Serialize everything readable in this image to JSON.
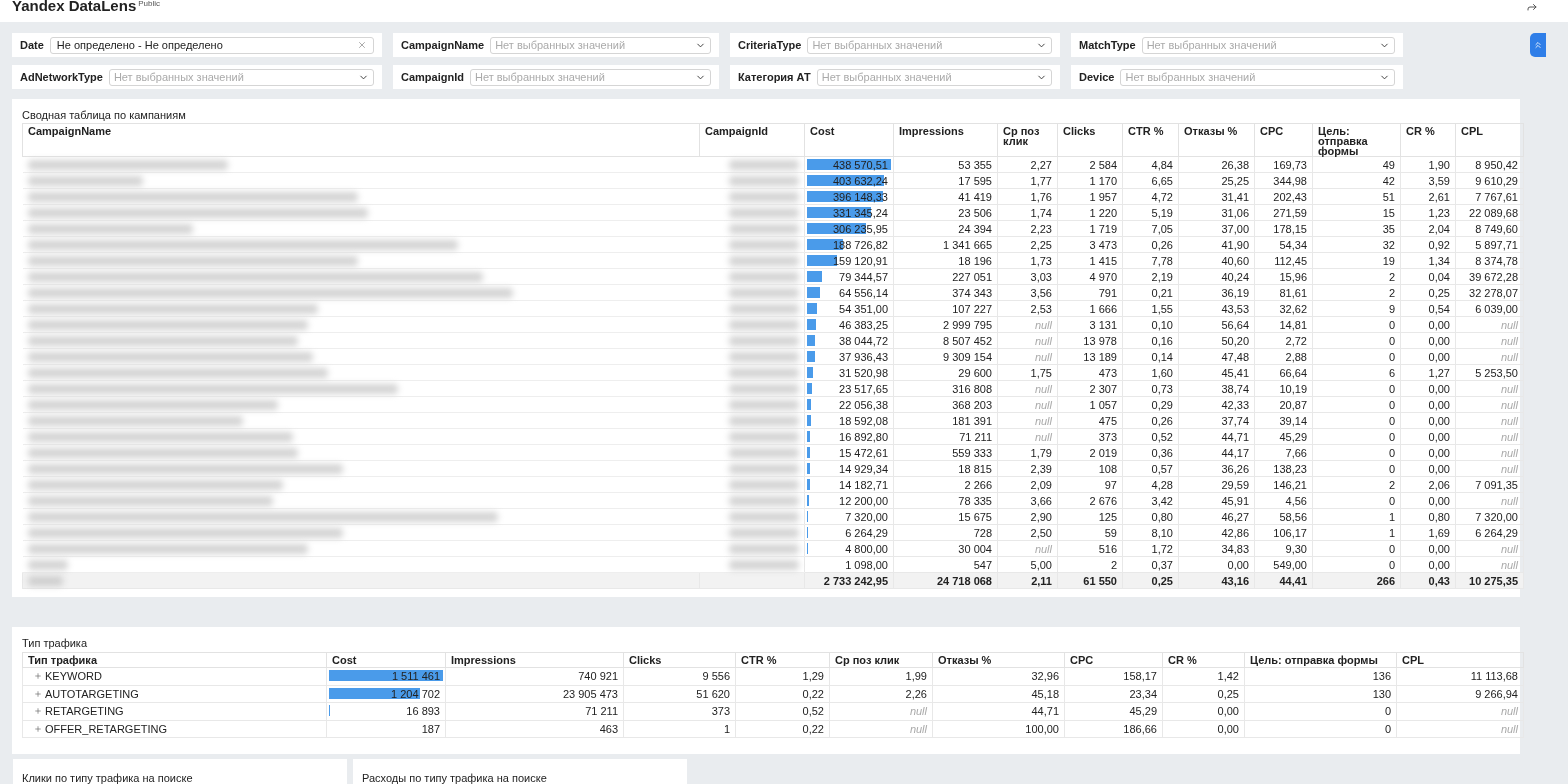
{
  "app": {
    "title": "Yandex DataLens",
    "badge": "Public"
  },
  "filters": [
    {
      "kind": "date",
      "label": "Date",
      "value": "Не определено - Не определено"
    },
    {
      "kind": "select",
      "label": "CampaignName",
      "placeholder": "Нет выбранных значений"
    },
    {
      "kind": "select",
      "label": "CriteriaType",
      "placeholder": "Нет выбранных значений"
    },
    {
      "kind": "select",
      "label": "MatchType",
      "placeholder": "Нет выбранных значений"
    },
    {
      "kind": "select",
      "label": "AdNetworkType",
      "placeholder": "Нет выбранных значений"
    },
    {
      "kind": "select",
      "label": "CampaignId",
      "placeholder": "Нет выбранных значений"
    },
    {
      "kind": "select",
      "label": "Категория АТ",
      "placeholder": "Нет выбранных значений"
    },
    {
      "kind": "select",
      "label": "Device",
      "placeholder": "Нет выбранных значений"
    }
  ],
  "campaign_table": {
    "title": "Сводная таблица по кампаниям",
    "columns": [
      "CampaignName",
      "CampaignId",
      "Cost",
      "Impressions",
      "Ср поз клик",
      "Clicks",
      "CTR %",
      "Отказы %",
      "CPC",
      "Цель: отправка формы",
      "CR %",
      "CPL"
    ],
    "rows": [
      {
        "level": 1,
        "cells": [
          "",
          "",
          "438 570,51",
          "53 355",
          "2,27",
          "2 584",
          "4,84",
          "26,38",
          "169,73",
          "49",
          "1,90",
          "8 950,42"
        ]
      },
      {
        "level": 0.92,
        "cells": [
          "",
          "",
          "403 632,24",
          "17 595",
          "1,77",
          "1 170",
          "6,65",
          "25,25",
          "344,98",
          "42",
          "3,59",
          "9 610,29"
        ]
      },
      {
        "level": 0.9,
        "cells": [
          "",
          "",
          "396 148,33",
          "41 419",
          "1,76",
          "1 957",
          "4,72",
          "31,41",
          "202,43",
          "51",
          "2,61",
          "7 767,61"
        ]
      },
      {
        "level": 0.76,
        "cells": [
          "",
          "",
          "331 345,24",
          "23 506",
          "1,74",
          "1 220",
          "5,19",
          "31,06",
          "271,59",
          "15",
          "1,23",
          "22 089,68"
        ]
      },
      {
        "level": 0.7,
        "cells": [
          "",
          "",
          "306 235,95",
          "24 394",
          "2,23",
          "1 719",
          "7,05",
          "37,00",
          "178,15",
          "35",
          "2,04",
          "8 749,60"
        ]
      },
      {
        "level": 0.43,
        "cells": [
          "",
          "",
          "188 726,82",
          "1 341 665",
          "2,25",
          "3 473",
          "0,26",
          "41,90",
          "54,34",
          "32",
          "0,92",
          "5 897,71"
        ]
      },
      {
        "level": 0.36,
        "cells": [
          "",
          "",
          "159 120,91",
          "18 196",
          "1,73",
          "1 415",
          "7,78",
          "40,60",
          "112,45",
          "19",
          "1,34",
          "8 374,78"
        ]
      },
      {
        "level": 0.18,
        "cells": [
          "",
          "",
          "79 344,57",
          "227 051",
          "3,03",
          "4 970",
          "2,19",
          "40,24",
          "15,96",
          "2",
          "0,04",
          "39 672,28"
        ]
      },
      {
        "level": 0.15,
        "cells": [
          "",
          "",
          "64 556,14",
          "374 343",
          "3,56",
          "791",
          "0,21",
          "36,19",
          "81,61",
          "2",
          "0,25",
          "32 278,07"
        ]
      },
      {
        "level": 0.12,
        "cells": [
          "",
          "",
          "54 351,00",
          "107 227",
          "2,53",
          "1 666",
          "1,55",
          "43,53",
          "32,62",
          "9",
          "0,54",
          "6 039,00"
        ]
      },
      {
        "level": 0.11,
        "cells": [
          "",
          "",
          "46 383,25",
          "2 999 795",
          {
            "kind": "null",
            "text": "null"
          },
          "3 131",
          "0,10",
          "56,64",
          "14,81",
          "0",
          "0,00",
          {
            "kind": "null",
            "text": "null"
          }
        ]
      },
      {
        "level": 0.09,
        "cells": [
          "",
          "",
          "38 044,72",
          "8 507 452",
          {
            "kind": "null",
            "text": "null"
          },
          "13 978",
          "0,16",
          "50,20",
          "2,72",
          "0",
          "0,00",
          {
            "kind": "null",
            "text": "null"
          }
        ]
      },
      {
        "level": 0.09,
        "cells": [
          "",
          "",
          "37 936,43",
          "9 309 154",
          {
            "kind": "null",
            "text": "null"
          },
          "13 189",
          "0,14",
          "47,48",
          "2,88",
          "0",
          "0,00",
          {
            "kind": "null",
            "text": "null"
          }
        ]
      },
      {
        "level": 0.07,
        "cells": [
          "",
          "",
          "31 520,98",
          "29 600",
          "1,75",
          "473",
          "1,60",
          "45,41",
          "66,64",
          "6",
          "1,27",
          "5 253,50"
        ]
      },
      {
        "level": 0.054,
        "cells": [
          "",
          "",
          "23 517,65",
          "316 808",
          {
            "kind": "null",
            "text": "null"
          },
          "2 307",
          "0,73",
          "38,74",
          "10,19",
          "0",
          "0,00",
          {
            "kind": "null",
            "text": "null"
          }
        ]
      },
      {
        "level": 0.05,
        "cells": [
          "",
          "",
          "22 056,38",
          "368 203",
          {
            "kind": "null",
            "text": "null"
          },
          "1 057",
          "0,29",
          "42,33",
          "20,87",
          "0",
          "0,00",
          {
            "kind": "null",
            "text": "null"
          }
        ]
      },
      {
        "level": 0.042,
        "cells": [
          "",
          "",
          "18 592,08",
          "181 391",
          {
            "kind": "null",
            "text": "null"
          },
          "475",
          "0,26",
          "37,74",
          "39,14",
          "0",
          "0,00",
          {
            "kind": "null",
            "text": "null"
          }
        ]
      },
      {
        "level": 0.039,
        "cells": [
          "",
          "",
          "16 892,80",
          "71 211",
          {
            "kind": "null",
            "text": "null"
          },
          "373",
          "0,52",
          "44,71",
          "45,29",
          "0",
          "0,00",
          {
            "kind": "null",
            "text": "null"
          }
        ]
      },
      {
        "level": 0.035,
        "cells": [
          "",
          "",
          "15 472,61",
          "559 333",
          "1,79",
          "2 019",
          "0,36",
          "44,17",
          "7,66",
          "0",
          "0,00",
          {
            "kind": "null",
            "text": "null"
          }
        ]
      },
      {
        "level": 0.034,
        "cells": [
          "",
          "",
          "14 929,34",
          "18 815",
          "2,39",
          "108",
          "0,57",
          "36,26",
          "138,23",
          "0",
          "0,00",
          {
            "kind": "null",
            "text": "null"
          }
        ]
      },
      {
        "level": 0.032,
        "cells": [
          "",
          "",
          "14 182,71",
          "2 266",
          "2,09",
          "97",
          "4,28",
          "29,59",
          "146,21",
          "2",
          "2,06",
          "7 091,35"
        ]
      },
      {
        "level": 0.028,
        "cells": [
          "",
          "",
          "12 200,00",
          "78 335",
          "3,66",
          "2 676",
          "3,42",
          "45,91",
          "4,56",
          "0",
          "0,00",
          {
            "kind": "null",
            "text": "null"
          }
        ]
      },
      {
        "level": 0.017,
        "cells": [
          "",
          "",
          "7 320,00",
          "15 675",
          "2,90",
          "125",
          "0,80",
          "46,27",
          "58,56",
          "1",
          "0,80",
          "7 320,00"
        ]
      },
      {
        "level": 0.014,
        "cells": [
          "",
          "",
          "6 264,29",
          "728",
          "2,50",
          "59",
          "8,10",
          "42,86",
          "106,17",
          "1",
          "1,69",
          "6 264,29"
        ]
      },
      {
        "level": 0.011,
        "cells": [
          "",
          "",
          "4 800,00",
          "30 004",
          {
            "kind": "null",
            "text": "null"
          },
          "516",
          "1,72",
          "34,83",
          "9,30",
          "0",
          "0,00",
          {
            "kind": "null",
            "text": "null"
          }
        ]
      },
      {
        "cells": [
          "",
          "",
          "1 098,00",
          "547",
          "5,00",
          "2",
          "0,37",
          "0,00",
          "549,00",
          "0",
          "0,00",
          {
            "kind": "null",
            "text": "null"
          }
        ]
      },
      {
        "kind": "total",
        "cells": [
          "",
          "",
          "2 733 242,95",
          "24 718 068",
          "2,11",
          "61 550",
          "0,25",
          "43,16",
          "44,41",
          "266",
          "0,43",
          "10 275,35"
        ]
      }
    ]
  },
  "traffic_table": {
    "title": "Тип трафика",
    "columns": [
      "Тип трафика",
      "Cost",
      "Impressions",
      "Clicks",
      "CTR %",
      "Ср поз клик",
      "Отказы %",
      "CPC",
      "CR %",
      "Цель: отправка формы",
      "CPL"
    ],
    "rows": [
      {
        "expanded": false,
        "level": 1,
        "cells": [
          "KEYWORD",
          "1 511 461",
          "740 921",
          "9 556",
          "1,29",
          "1,99",
          "32,96",
          "158,17",
          "1,42",
          "136",
          "11 113,68"
        ]
      },
      {
        "expanded": false,
        "level": 0.8,
        "cells": [
          "AUTOTARGETING",
          "1 204 702",
          "23 905 473",
          "51 620",
          "0,22",
          "2,26",
          "45,18",
          "23,34",
          "0,25",
          "130",
          "9 266,94"
        ]
      },
      {
        "expanded": false,
        "level": 0.011,
        "cells": [
          "RETARGETING",
          "16 893",
          "71 211",
          "373",
          "0,52",
          {
            "kind": "null",
            "text": "null"
          },
          "44,71",
          "45,29",
          "0,00",
          "0",
          {
            "kind": "null",
            "text": "null"
          }
        ]
      },
      {
        "expanded": false,
        "cells": [
          "OFFER_RETARGETING",
          "187",
          "463",
          "1",
          "0,22",
          {
            "kind": "null",
            "text": "null"
          },
          "100,00",
          "186,66",
          "0,00",
          "0",
          {
            "kind": "null",
            "text": "null"
          }
        ]
      }
    ]
  },
  "bottom_cards": [
    {
      "title": "Клики по типу трафика на поиске"
    },
    {
      "title": "Расходы по типу трафика на поиске"
    }
  ]
}
